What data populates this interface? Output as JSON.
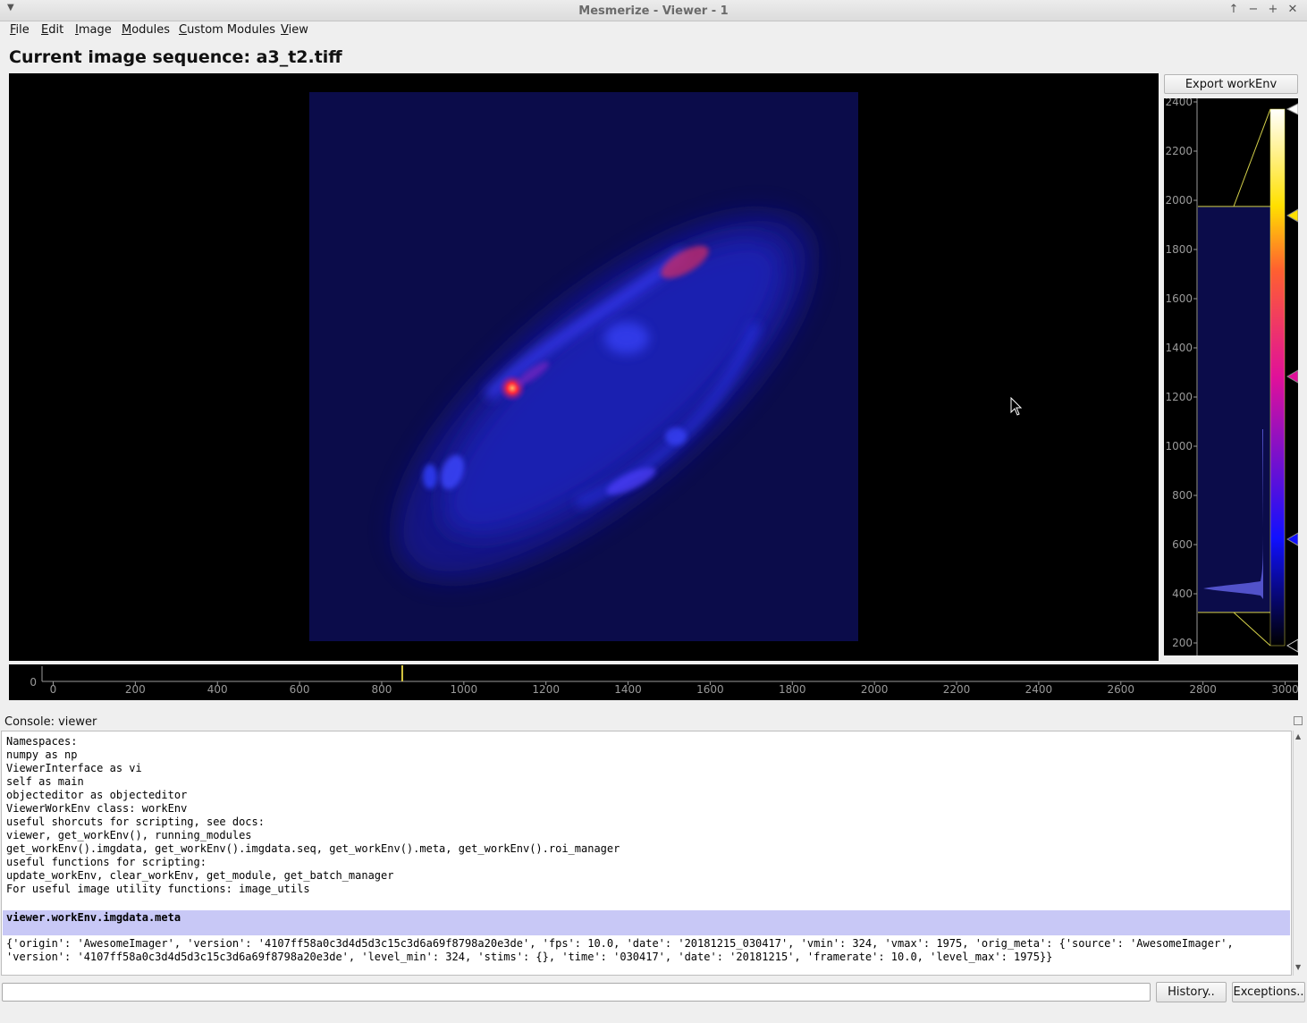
{
  "window": {
    "title": "Mesmerize - Viewer - 1",
    "controls": [
      "↑",
      "−",
      "+",
      "✕"
    ]
  },
  "menu": [
    {
      "label": "File",
      "mnemonic": "F"
    },
    {
      "label": "Edit",
      "mnemonic": "E"
    },
    {
      "label": "Image",
      "mnemonic": "I"
    },
    {
      "label": "Modules",
      "mnemonic": "M"
    },
    {
      "label": "Custom Modules",
      "mnemonic": "C"
    },
    {
      "label": "View",
      "mnemonic": "V"
    }
  ],
  "heading": "Current image sequence: a3_t2.tiff",
  "export_button": "Export workEnv",
  "histogram": {
    "axis_ticks": [
      "2400",
      "2200",
      "2000",
      "1800",
      "1600",
      "1400",
      "1200",
      "1000",
      "800",
      "600",
      "400",
      "200"
    ],
    "level_min": 324,
    "level_max": 1975,
    "colormap": "fire",
    "colors": {
      "ticks": "#9a9a9a",
      "region": "#0b0c4a",
      "line": "#d6d24a"
    }
  },
  "timeline": {
    "y_label": "0",
    "ticks": [
      "0",
      "200",
      "400",
      "600",
      "800",
      "1000",
      "1200",
      "1400",
      "1600",
      "1800",
      "2000",
      "2200",
      "2400",
      "2600",
      "2800",
      "3000"
    ],
    "current_frame": 850,
    "max_frame": 3000,
    "colors": {
      "ticks": "#9a9a9a",
      "marker": "#d8c840"
    }
  },
  "console": {
    "label": "Console: viewer",
    "lines": [
      "Namespaces:",
      "numpy as np",
      "ViewerInterface as vi",
      "self as main",
      "objecteditor as objecteditor",
      "ViewerWorkEnv class: workEnv",
      "useful shorcuts for scripting, see docs:",
      "viewer, get_workEnv(), running_modules",
      "get_workEnv().imgdata, get_workEnv().imgdata.seq, get_workEnv().meta, get_workEnv().roi_manager",
      "useful functions for scripting:",
      "update_workEnv, clear_workEnv, get_module, get_batch_manager",
      "For useful image utility functions: image_utils"
    ],
    "command": "viewer.workEnv.imgdata.meta",
    "output": [
      "{'origin': 'AwesomeImager', 'version': '4107ff58a0c3d4d5d3c15c3d6a69f8798a20e3de', 'fps': 10.0, 'date': '20181215_030417', 'vmin': 324, 'vmax': 1975, 'orig_meta': {'source': 'AwesomeImager',",
      "'version': '4107ff58a0c3d4d5d3c15c3d6a69f8798a20e3de', 'level_min': 324, 'stims': {}, 'time': '030417', 'date': '20181215', 'framerate': 10.0, 'level_max': 1975}}"
    ],
    "input_value": "",
    "history_button": "History..",
    "exceptions_button": "Exceptions.."
  }
}
